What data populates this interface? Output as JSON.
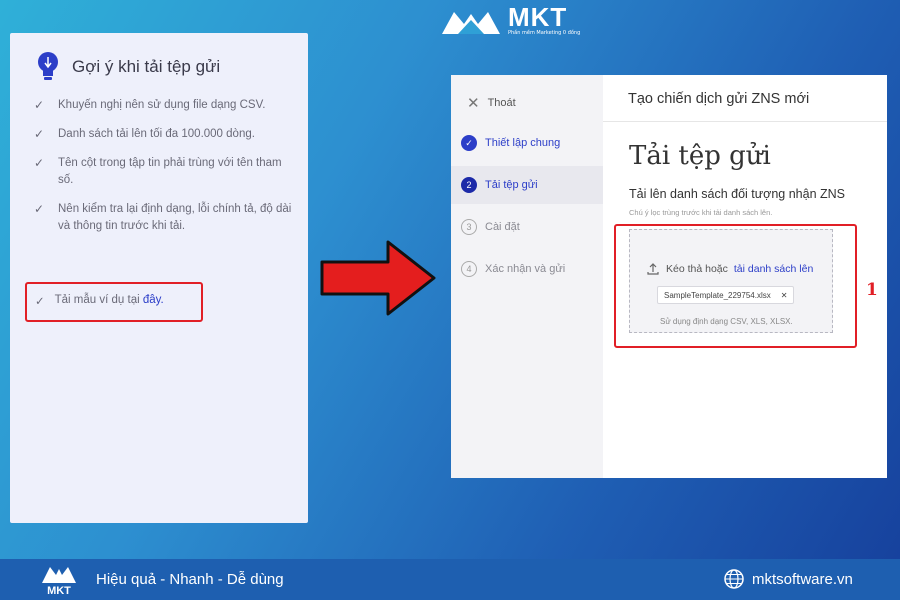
{
  "brand": {
    "name": "MKT",
    "subtitle": "Phần mềm Marketing 0 đồng",
    "tagline": "Hiệu quả - Nhanh - Dễ dùng",
    "website": "mktsoftware.vn",
    "colors": {
      "accent_red": "#e11f26",
      "link_blue": "#2c3ec8",
      "footer_blue": "#1e5fb0"
    }
  },
  "tips_panel": {
    "icon": "lightbulb-icon",
    "title": "Gợi ý khi tải tệp gửi",
    "items": [
      "Khuyến nghị nên sử dụng file dạng CSV.",
      "Danh sách tải lên tối đa 100.000 dòng.",
      "Tên cột trong tập tin phải trùng với tên tham số.",
      "Nên kiểm tra lại định dạng, lỗi chính tả, độ dài và thông tin trước khi tải."
    ],
    "highlight_item": {
      "text": "Tải mẫu ví dụ tại",
      "link": "đây."
    }
  },
  "wizard": {
    "exit_label": "Thoát",
    "header_title": "Tạo chiến dịch gửi ZNS mới",
    "steps": [
      {
        "num": "✓",
        "label": "Thiết lập chung",
        "state": "done"
      },
      {
        "num": "2",
        "label": "Tải tệp gửi",
        "state": "active"
      },
      {
        "num": "3",
        "label": "Cài đặt",
        "state": "pending"
      },
      {
        "num": "4",
        "label": "Xác nhận và gửi",
        "state": "pending"
      }
    ],
    "page_title": "Tải tệp gửi",
    "section_title": "Tải lên danh sách đối tượng nhận ZNS",
    "section_hint": "Chú ý lọc trùng trước khi tải danh sách lên.",
    "dropzone": {
      "text": "Kéo thả hoặc",
      "link": "tải danh sách lên",
      "file_name": "SampleTemplate_229754.xlsx",
      "formats": "Sử dụng định dạng CSV, XLS, XLSX."
    },
    "annotation_number": "1"
  }
}
